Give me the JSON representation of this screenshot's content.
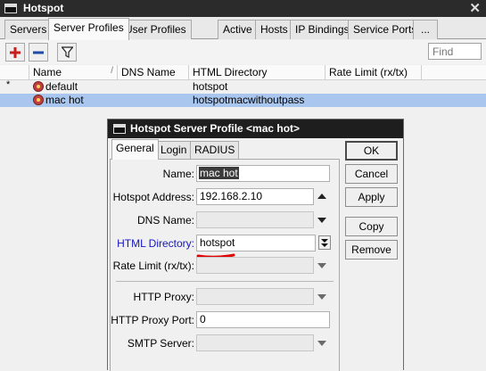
{
  "window": {
    "title": "Hotspot"
  },
  "tabs": [
    "Servers",
    "Server Profiles",
    "User Profiles",
    "Active",
    "Hosts",
    "IP Bindings",
    "Service Ports",
    "..."
  ],
  "active_tab": "Server Profiles",
  "toolbar": {
    "find_placeholder": "Find"
  },
  "table": {
    "columns": [
      "Name",
      "DNS Name",
      "HTML Directory",
      "Rate Limit (rx/tx)"
    ],
    "rows": [
      {
        "flag": "*",
        "name": "default",
        "dns_name": "",
        "html_directory": "hotspot",
        "rate_limit": "",
        "selected": false
      },
      {
        "flag": "",
        "name": "mac hot",
        "dns_name": "",
        "html_directory": "hotspotmacwithoutpass",
        "rate_limit": "",
        "selected": true
      }
    ]
  },
  "dialog": {
    "title": "Hotspot Server Profile <mac hot>",
    "tabs": [
      "General",
      "Login",
      "RADIUS"
    ],
    "active_tab": "General",
    "fields": {
      "name": {
        "label": "Name:",
        "value": "mac hot"
      },
      "hotspot_address": {
        "label": "Hotspot Address:",
        "value": "192.168.2.10"
      },
      "dns_name": {
        "label": "DNS Name:",
        "value": ""
      },
      "html_directory": {
        "label": "HTML Directory:",
        "value": "hotspot"
      },
      "rate_limit": {
        "label": "Rate Limit (rx/tx):",
        "value": ""
      },
      "http_proxy": {
        "label": "HTTP Proxy:",
        "value": ""
      },
      "http_proxy_port": {
        "label": "HTTP Proxy Port:",
        "value": "0"
      },
      "smtp_server": {
        "label": "SMTP Server:",
        "value": ""
      }
    },
    "buttons": {
      "ok": "OK",
      "cancel": "Cancel",
      "apply": "Apply",
      "copy": "Copy",
      "remove": "Remove"
    }
  },
  "colors": {
    "selected_row": "#a9c6ee",
    "highlight_label": "#1515c4",
    "annotation": "#e00000",
    "add_icon": "#c81e1e"
  }
}
